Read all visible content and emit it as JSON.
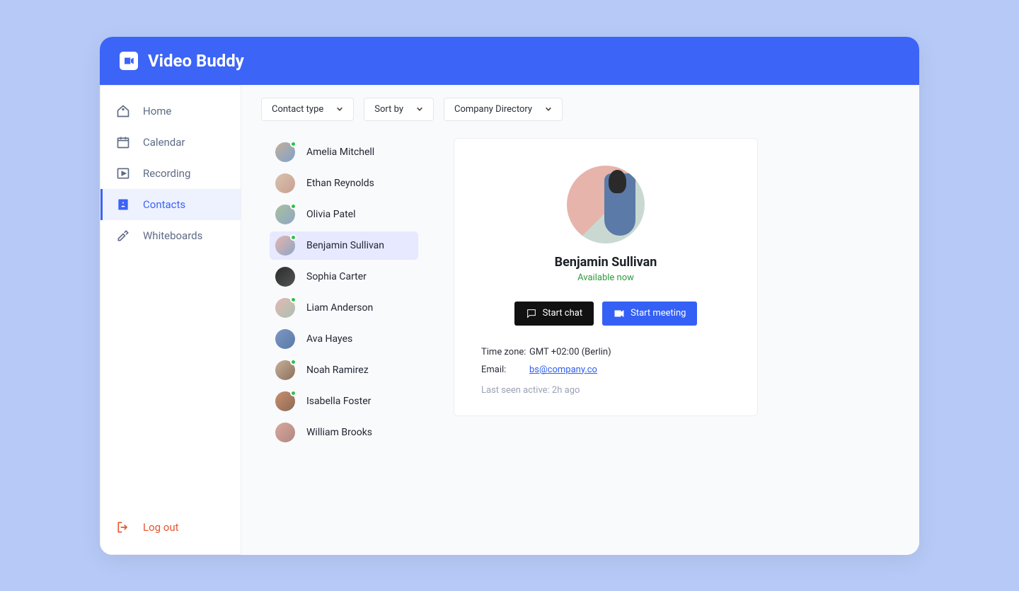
{
  "brand": "Video Buddy",
  "sidebar": {
    "items": [
      {
        "label": "Home"
      },
      {
        "label": "Calendar"
      },
      {
        "label": "Recording"
      },
      {
        "label": "Contacts"
      },
      {
        "label": "Whiteboards"
      }
    ],
    "logout_label": "Log out"
  },
  "filters": {
    "contact_type": "Contact type",
    "sort_by": "Sort by",
    "directory": "Company Directory"
  },
  "contacts": [
    {
      "name": "Amelia Mitchell",
      "online": true
    },
    {
      "name": "Ethan Reynolds",
      "online": false
    },
    {
      "name": "Olivia Patel",
      "online": true
    },
    {
      "name": "Benjamin Sullivan",
      "online": true,
      "selected": true
    },
    {
      "name": "Sophia Carter",
      "online": false
    },
    {
      "name": "Liam Anderson",
      "online": true
    },
    {
      "name": "Ava Hayes",
      "online": false
    },
    {
      "name": "Noah Ramirez",
      "online": true
    },
    {
      "name": "Isabella Foster",
      "online": true
    },
    {
      "name": "William Brooks",
      "online": false
    }
  ],
  "detail": {
    "name": "Benjamin Sullivan",
    "status": "Available now",
    "chat_label": "Start chat",
    "meeting_label": "Start meeting",
    "timezone_label": "Time zone:",
    "timezone_value": "GMT +02:00 (Berlin)",
    "email_label": "Email:",
    "email_value": "bs@company.co",
    "last_seen": "Last seen active: 2h ago"
  }
}
